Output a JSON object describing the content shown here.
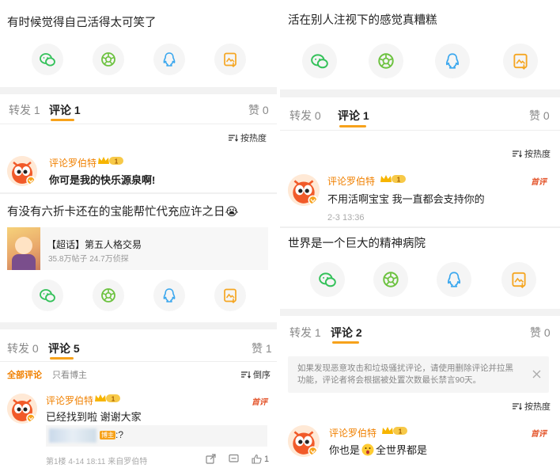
{
  "left": {
    "post1": {
      "text": "有时候觉得自己活得太可笑了",
      "tabs": {
        "repost": "转发 1",
        "comment": "评论 1",
        "like": "赞 0"
      },
      "sort": "按热度",
      "comment": {
        "author": "评论罗伯特",
        "text": "你可是我的快乐源泉啊!"
      }
    },
    "post2": {
      "text": "有没有六折卡还在的宝能帮忙代充应许之日😭",
      "topic": {
        "title": "【超话】第五人格交易",
        "stats": "35.8万帖子 24.7万侦探"
      },
      "tabs": {
        "repost": "转发 0",
        "comment": "评论 5",
        "like": "赞 1"
      },
      "filter_all": "全部评论",
      "filter_blogger": "只看博主",
      "sort": "倒序",
      "comment": {
        "author": "评论罗伯特",
        "tag": "首评",
        "text": "已经找到啦 谢谢大家",
        "reply_suffix": ":?",
        "reply_badge": "博主",
        "meta": "第1楼 4-14 18:11 来自罗伯特",
        "like_count": "1"
      }
    }
  },
  "right": {
    "post1": {
      "text": "活在别人注视下的感觉真糟糕",
      "tabs": {
        "repost": "转发 0",
        "comment": "评论 1",
        "like": "赞 0"
      },
      "sort": "按热度",
      "comment": {
        "author": "评论罗伯特",
        "tag": "首评",
        "text": "不用活啊宝宝 我一直都会支持你的",
        "time": "2-3 13:36"
      }
    },
    "post2": {
      "text": "世界是一个巨大的精神病院",
      "tabs": {
        "repost": "转发 1",
        "comment": "评论 2",
        "like": "赞 0"
      },
      "notice": "如果发现恶意攻击和垃圾骚扰评论，请使用删除评论并拉黑功能，评论者将会根据被处置次数最长禁言90天。",
      "sort": "按热度",
      "comment": {
        "author": "评论罗伯特",
        "tag": "首评",
        "text_before": "你也是",
        "text_after": "全世界都是"
      }
    }
  },
  "icons": [
    "wechat-icon",
    "moments-icon",
    "qq-icon",
    "save-image-icon"
  ],
  "colors": {
    "wechat": "#33c159",
    "moments": "#6cc23f",
    "qq": "#3aa7ee",
    "save": "#f5a623",
    "accent": "#f7a21b",
    "author": "#f08000"
  }
}
